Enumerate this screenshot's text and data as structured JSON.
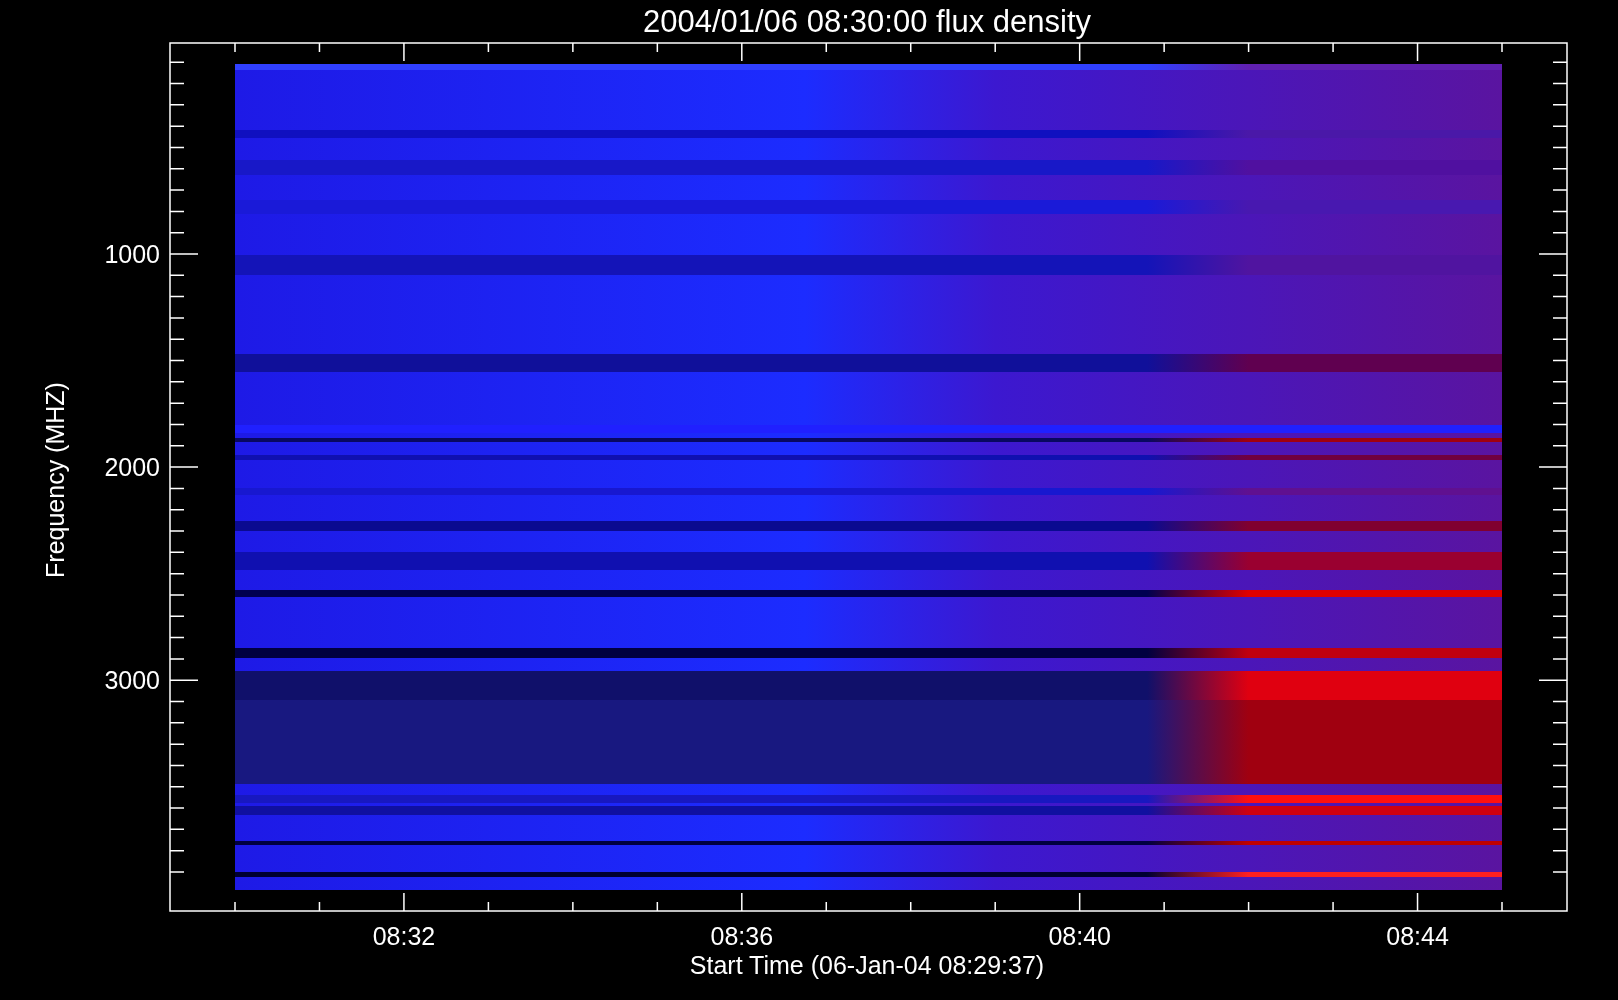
{
  "title": "2004/01/06 08:30:00 flux density",
  "y_axis": {
    "label": "Frequency (MHZ)",
    "tick_labels": [
      "1000",
      "2000",
      "3000"
    ]
  },
  "x_axis": {
    "label": "Start Time (06-Jan-04 08:29:37)",
    "tick_labels": [
      "08:32",
      "08:36",
      "08:40",
      "08:44"
    ]
  }
}
